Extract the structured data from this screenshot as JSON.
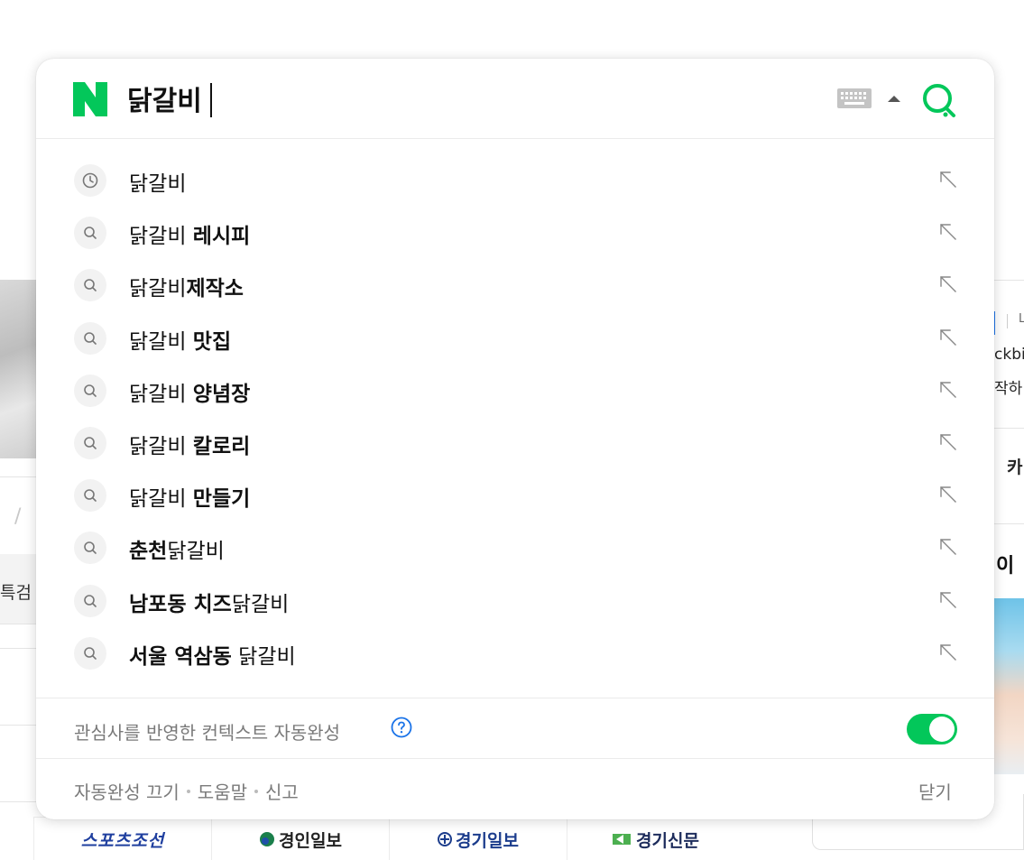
{
  "search": {
    "query": "닭갈비"
  },
  "suggestions": [
    {
      "type": "history",
      "parts": [
        {
          "text": "닭갈비",
          "bold": false
        }
      ]
    },
    {
      "type": "search",
      "parts": [
        {
          "text": "닭갈비 ",
          "bold": false
        },
        {
          "text": "레시피",
          "bold": true
        }
      ]
    },
    {
      "type": "search",
      "parts": [
        {
          "text": "닭갈비",
          "bold": false
        },
        {
          "text": "제작소",
          "bold": true
        }
      ]
    },
    {
      "type": "search",
      "parts": [
        {
          "text": "닭갈비 ",
          "bold": false
        },
        {
          "text": "맛집",
          "bold": true
        }
      ]
    },
    {
      "type": "search",
      "parts": [
        {
          "text": "닭갈비 ",
          "bold": false
        },
        {
          "text": "양념장",
          "bold": true
        }
      ]
    },
    {
      "type": "search",
      "parts": [
        {
          "text": "닭갈비 ",
          "bold": false
        },
        {
          "text": "칼로리",
          "bold": true
        }
      ]
    },
    {
      "type": "search",
      "parts": [
        {
          "text": "닭갈비 ",
          "bold": false
        },
        {
          "text": "만들기",
          "bold": true
        }
      ]
    },
    {
      "type": "search",
      "parts": [
        {
          "text": "춘천",
          "bold": true
        },
        {
          "text": "닭갈비",
          "bold": false
        }
      ]
    },
    {
      "type": "search",
      "parts": [
        {
          "text": "남포동 치즈",
          "bold": true
        },
        {
          "text": "닭갈비",
          "bold": false
        }
      ]
    },
    {
      "type": "search",
      "parts": [
        {
          "text": "서울 역삼동",
          "bold": true
        },
        {
          "text": " 닭갈비",
          "bold": false
        }
      ]
    }
  ],
  "context": {
    "label": "관심사를 반영한 컨텍스트 자동완성",
    "enabled": true
  },
  "footer": {
    "autocomplete_off": "자동완성 끄기",
    "help": "도움말",
    "report": "신고",
    "close": "닫기"
  },
  "background": {
    "left_tab": "특검",
    "right_text_1": "L",
    "right_text_2": "ckbi",
    "right_text_3": "작하",
    "right_text_4": "카",
    "right_text_5": "이",
    "news": [
      "스포츠조선",
      "경인일보",
      "경기일보",
      "경기신문"
    ]
  },
  "colors": {
    "brand_green": "#03c75a",
    "help_blue": "#1a73e8"
  }
}
